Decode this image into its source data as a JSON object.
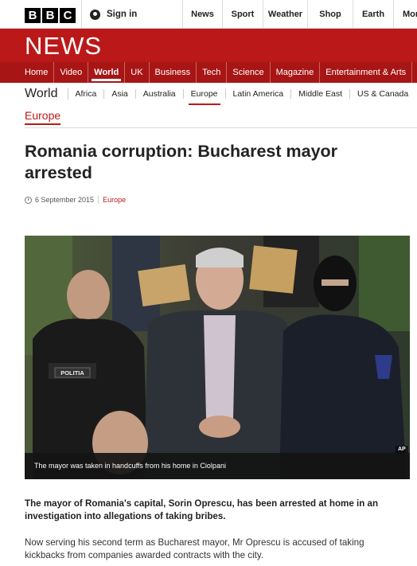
{
  "brand": {
    "letters": [
      "B",
      "B",
      "C"
    ],
    "news_logo": "NEWS"
  },
  "account": {
    "signin_label": "Sign in"
  },
  "top_nav": [
    "News",
    "Sport",
    "Weather",
    "Shop",
    "Earth",
    "More"
  ],
  "news_nav": [
    "Home",
    "Video",
    "World",
    "UK",
    "Business",
    "Tech",
    "Science",
    "Magazine",
    "Entertainment & Arts"
  ],
  "world_nav": {
    "title": "World",
    "items": [
      "Africa",
      "Asia",
      "Australia",
      "Europe",
      "Latin America",
      "Middle East",
      "US & Canada"
    ]
  },
  "subsection": "Europe",
  "article": {
    "headline": "Romania corruption: Bucharest mayor arrested",
    "date": "6 September 2015",
    "category": "Europe",
    "image": {
      "caption": "The mayor was taken in handcuffs from his home in Ciolpani",
      "credit": "AP",
      "vest_label": "POLITIA"
    },
    "lead": "The mayor of Romania's capital, Sorin Oprescu, has been arrested at home in an investigation into allegations of taking bribes.",
    "paragraph_1": "Now serving his second term as Bucharest mayor, Mr Oprescu is accused of taking kickbacks from companies awarded contracts with the city."
  },
  "colors": {
    "brand_red": "#bb1919",
    "nav_red": "#a81515"
  }
}
